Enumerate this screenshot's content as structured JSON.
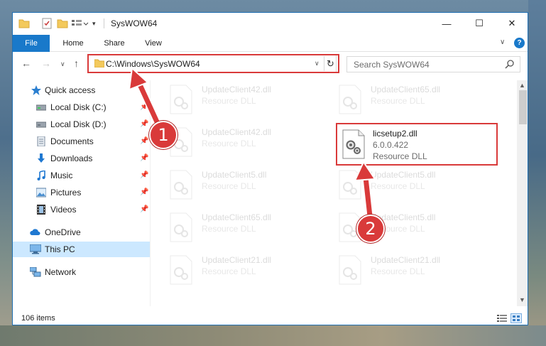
{
  "window": {
    "title": "SysWOW64",
    "controls": {
      "minimize": "—",
      "maximize": "☐",
      "close": "✕"
    }
  },
  "ribbon": {
    "tabs": [
      "File",
      "Home",
      "Share",
      "View"
    ],
    "expand_glyph": "∨",
    "help_glyph": "?"
  },
  "address": {
    "path": "C:\\Windows\\SysWOW64",
    "refresh_glyph": "↻"
  },
  "search": {
    "placeholder": "Search SysWOW64"
  },
  "navigation": {
    "back": "←",
    "forward": "→",
    "recent": "∨",
    "up": "↑"
  },
  "sidebar": {
    "items": [
      {
        "label": "Quick access",
        "icon": "star-icon",
        "pinned": false
      },
      {
        "label": "Local Disk (C:)",
        "icon": "drive-icon",
        "pinned": true
      },
      {
        "label": "Local Disk (D:)",
        "icon": "drive-icon",
        "pinned": true
      },
      {
        "label": "Documents",
        "icon": "documents-icon",
        "pinned": true
      },
      {
        "label": "Downloads",
        "icon": "downloads-icon",
        "pinned": true
      },
      {
        "label": "Music",
        "icon": "music-icon",
        "pinned": true
      },
      {
        "label": "Pictures",
        "icon": "pictures-icon",
        "pinned": true
      },
      {
        "label": "Videos",
        "icon": "videos-icon",
        "pinned": true
      },
      {
        "label": "OneDrive",
        "icon": "cloud-icon",
        "pinned": false
      },
      {
        "label": "This PC",
        "icon": "computer-icon",
        "pinned": false,
        "selected": true
      },
      {
        "label": "Network",
        "icon": "network-icon",
        "pinned": false
      }
    ]
  },
  "files": {
    "background_tiles": [
      {
        "name": "UpdateClient42.dll",
        "type": "Resource DLL"
      },
      {
        "name": "UpdateClient65.dll",
        "type": "Resource DLL"
      },
      {
        "name": "UpdateClient42.dll",
        "type": "Resource DLL"
      },
      {
        "name": "UpdateClient5.dll",
        "type": "Resource DLL"
      },
      {
        "name": "UpdateClient5.dll",
        "type": "Resource DLL"
      },
      {
        "name": "UpdateClient65.dll",
        "type": "Resource DLL"
      },
      {
        "name": "UpdateClient5.dll",
        "type": "Resource DLL"
      },
      {
        "name": "UpdateClient21.dll",
        "type": "Resource DLL"
      },
      {
        "name": "UpdateClient21.dll",
        "type": "Resource DLL"
      }
    ],
    "featured": {
      "name": "licsetup2.dll",
      "version": "6.0.0.422",
      "type": "Resource DLL"
    }
  },
  "status": {
    "item_count": "106 items"
  },
  "annotations": {
    "step1": "1",
    "step2": "2"
  },
  "colors": {
    "accent": "#1979ca",
    "highlight": "#d93a3a",
    "selected": "#cce8ff"
  }
}
